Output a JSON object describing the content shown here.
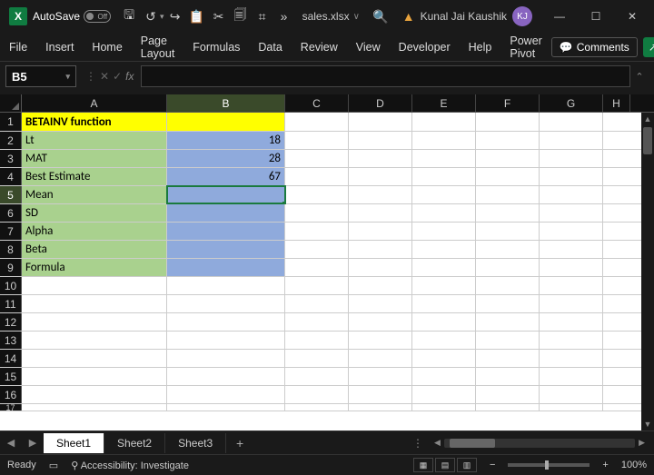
{
  "titlebar": {
    "autosave_label": "AutoSave",
    "autosave_state": "Off",
    "filename": "sales.xlsx",
    "username": "Kunal Jai Kaushik",
    "user_initials": "KJ"
  },
  "ribbon": {
    "tabs": [
      "File",
      "Insert",
      "Home",
      "Page Layout",
      "Formulas",
      "Data",
      "Review",
      "View",
      "Developer",
      "Help",
      "Power Pivot"
    ],
    "comments_label": "Comments"
  },
  "fxrow": {
    "namebox": "B5",
    "fx_label": "fx",
    "formula": ""
  },
  "columns": [
    "A",
    "B",
    "C",
    "D",
    "E",
    "F",
    "G",
    "H"
  ],
  "selected_column": "B",
  "selected_row": 5,
  "rows_visible": 16,
  "cells": {
    "r1": {
      "A": "BETAINV function",
      "B": ""
    },
    "r2": {
      "A": "Lt",
      "B": "18"
    },
    "r3": {
      "A": "MAT",
      "B": "28"
    },
    "r4": {
      "A": "Best Estimate",
      "B": "67"
    },
    "r5": {
      "A": "Mean",
      "B": ""
    },
    "r6": {
      "A": "SD",
      "B": ""
    },
    "r7": {
      "A": "Alpha",
      "B": ""
    },
    "r8": {
      "A": "Beta",
      "B": ""
    },
    "r9": {
      "A": "Formula",
      "B": ""
    }
  },
  "sheets": {
    "active": "Sheet1",
    "tabs": [
      "Sheet1",
      "Sheet2",
      "Sheet3"
    ]
  },
  "status": {
    "ready": "Ready",
    "accessibility": "Accessibility: Investigate",
    "zoom": "100%"
  }
}
